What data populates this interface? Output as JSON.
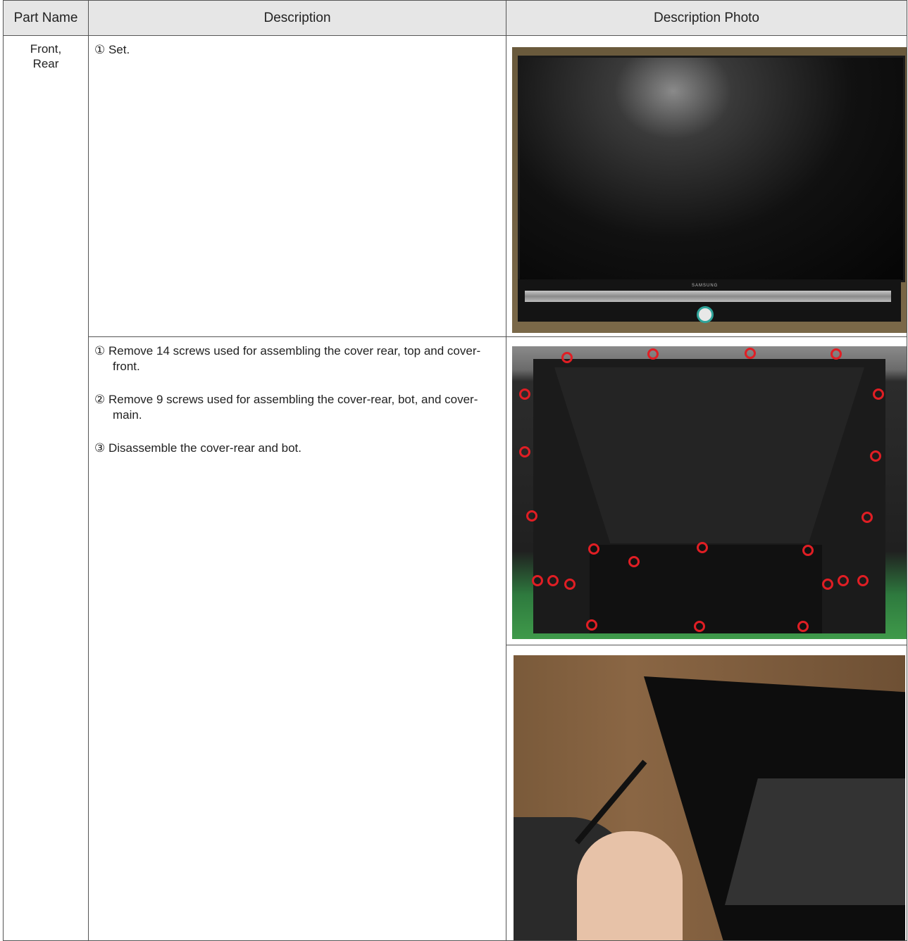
{
  "table": {
    "headers": [
      "Part Name",
      "Description",
      "Description Photo"
    ]
  },
  "rows": {
    "part_name_line1": "Front,",
    "part_name_line2": "Rear",
    "step1": {
      "items": [
        "① Set."
      ]
    },
    "step2": {
      "items": [
        "① Remove 14 screws used for assembling the cover rear, top and cover-front.",
        "② Remove 9 screws used for assembling the cover-rear, bot, and cover-main.",
        "③ Disassemble the cover-rear and bot."
      ]
    }
  },
  "photos": {
    "front_logo": "SAMSUNG",
    "screw_marker_color": "#e01e24"
  }
}
